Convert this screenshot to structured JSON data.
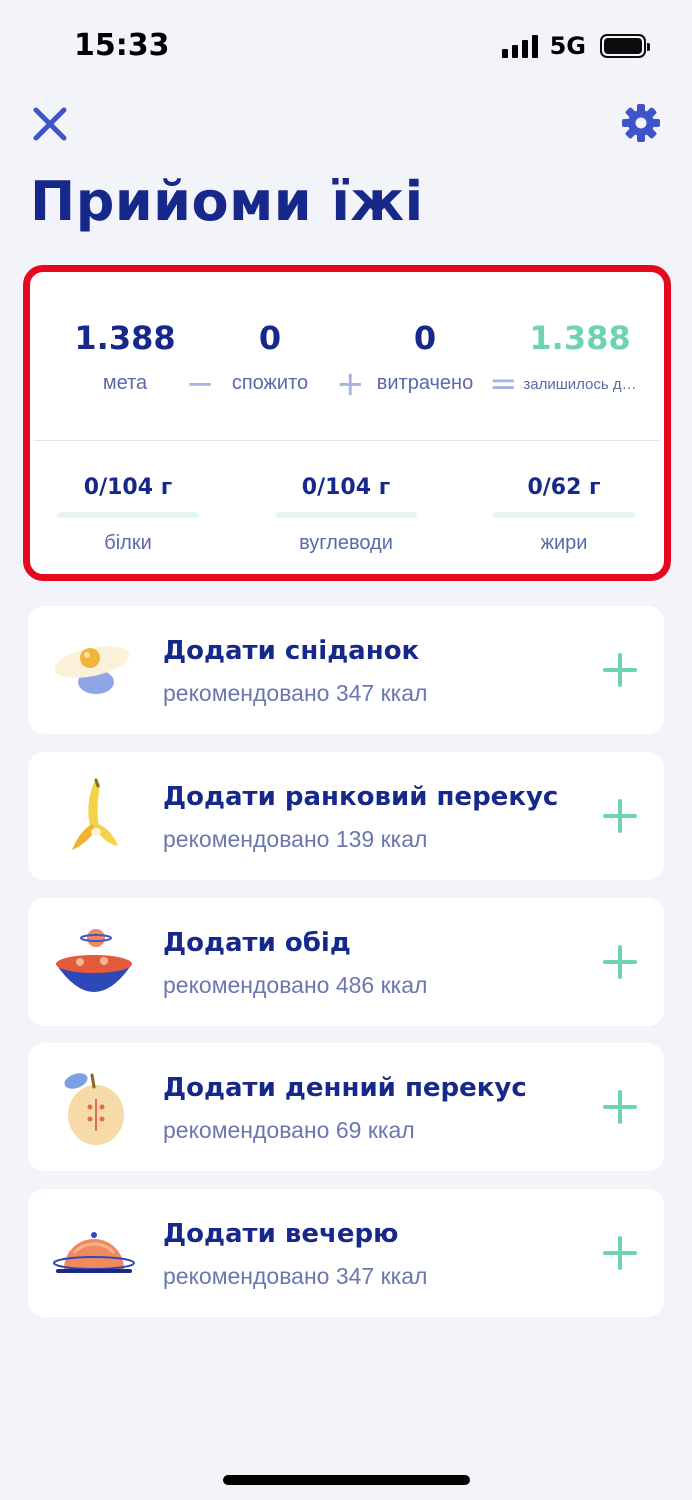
{
  "status_bar": {
    "time": "15:33",
    "network": "5G"
  },
  "header": {
    "title": "Прийоми їжі",
    "close_icon": "close-icon",
    "settings_icon": "gear-icon"
  },
  "summary": {
    "goal": {
      "value": "1.388",
      "label": "мета"
    },
    "consumed": {
      "value": "0",
      "label": "спожито"
    },
    "burned": {
      "value": "0",
      "label": "витрачено"
    },
    "remaining": {
      "value": "1.388",
      "label": "залишилось д…"
    },
    "operators": {
      "minus": "−",
      "plus": "+",
      "equals": "="
    },
    "accent_color": "#6fd3b2"
  },
  "macros": [
    {
      "value": "0/104 г",
      "label": "білки",
      "progress": 0
    },
    {
      "value": "0/104 г",
      "label": "вуглеводи",
      "progress": 0
    },
    {
      "value": "0/62 г",
      "label": "жири",
      "progress": 0
    }
  ],
  "meals": [
    {
      "title": "Додати сніданок",
      "subtitle": "рекомендовано 347 ккал",
      "icon": "fried-egg-icon"
    },
    {
      "title": "Додати ранковий перекус",
      "subtitle": "рекомендовано 139 ккал",
      "icon": "banana-icon"
    },
    {
      "title": "Додати обід",
      "subtitle": "рекомендовано 486 ккал",
      "icon": "bowl-icon"
    },
    {
      "title": "Додати денний перекус",
      "subtitle": "рекомендовано 69 ккал",
      "icon": "apple-icon"
    },
    {
      "title": "Додати вечерю",
      "subtitle": "рекомендовано 347 ккал",
      "icon": "cloche-icon"
    }
  ],
  "colors": {
    "primary": "#16288a",
    "accent": "#6fd3b2",
    "highlight_border": "#e5091e",
    "background": "#f3f4fa"
  }
}
